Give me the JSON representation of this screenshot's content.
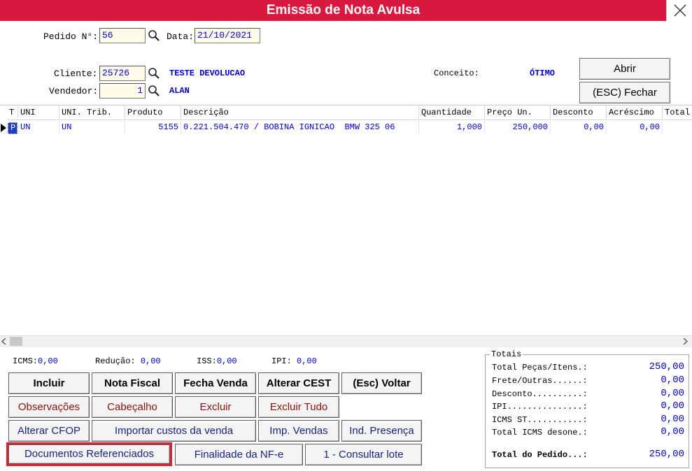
{
  "window": {
    "title": "Emissão de Nota Avulsa"
  },
  "header": {
    "pedido_label": "Pedido N°:",
    "pedido_value": "56",
    "data_label": "Data:",
    "data_value": "21/10/2021",
    "cliente_label": "Cliente:",
    "cliente_value": "25726",
    "cliente_nome": "TESTE DEVOLUCAO",
    "vendedor_label": "Vendedor:",
    "vendedor_value": "1",
    "vendedor_nome": "ALAN",
    "conceito_label": "Conceito:",
    "conceito_value": "ÓTIMO",
    "abrir_label": "Abrir",
    "fechar_label": "(ESC) Fechar"
  },
  "grid": {
    "columns": [
      "T",
      "UNI",
      "UNI. Trib.",
      "Produto",
      "Descrição",
      "Quantidade",
      "Preço Un.",
      "Desconto",
      "Acréscimo",
      "Total"
    ],
    "rows": [
      [
        "P",
        "UN",
        "UN",
        "5155",
        "0.221.504.470 / BOBINA IGNICAO  BMW 325 06",
        "1,000",
        "250,000",
        "0,00",
        "0,00",
        ""
      ]
    ]
  },
  "taxes": {
    "icms_label": "ICMS:",
    "icms_value": "0,00",
    "reducao_label": "Redução:",
    "reducao_value": "0,00",
    "iss_label": "ISS:",
    "iss_value": "0,00",
    "ipi_label": "IPI:",
    "ipi_value": "0,00"
  },
  "buttons": {
    "incluir": "Incluir",
    "nota_fiscal": "Nota Fiscal",
    "fecha_venda": "Fecha Venda",
    "alterar_cest": "Alterar CEST",
    "voltar": "(Esc) Voltar",
    "observacoes": "Observações",
    "cabecalho": "Cabeçalho",
    "excluir": "Excluir",
    "excluir_tudo": "Excluir Tudo",
    "alterar_cfop": "Alterar CFOP",
    "importar_custos": "Importar custos da venda",
    "imp_vendas": "Imp. Vendas",
    "ind_presenca": "Ind. Presença",
    "documentos_referenciados": "Documentos Referenciados",
    "finalidade_nfe": "Finalidade da NF-e",
    "consultar_lote": "1 - Consultar lote"
  },
  "totals": {
    "legend": "Totais",
    "items": [
      {
        "label": "Total Peças/Itens.:",
        "value": "250,00"
      },
      {
        "label": "Frete/Outras......:",
        "value": "0,00"
      },
      {
        "label": "Desconto..........:",
        "value": "0,00"
      },
      {
        "label": "IPI...............:",
        "value": "0,00"
      },
      {
        "label": "ICMS ST...........:",
        "value": "0,00"
      },
      {
        "label": "Total ICMS desone.:",
        "value": "0,00"
      }
    ],
    "total_pedido_label": "Total do Pedido...:",
    "total_pedido_value": "250,00"
  },
  "colors": {
    "titlebar": "#d9183f",
    "value_blue": "#0000cc",
    "highlight": "#e0202a"
  }
}
